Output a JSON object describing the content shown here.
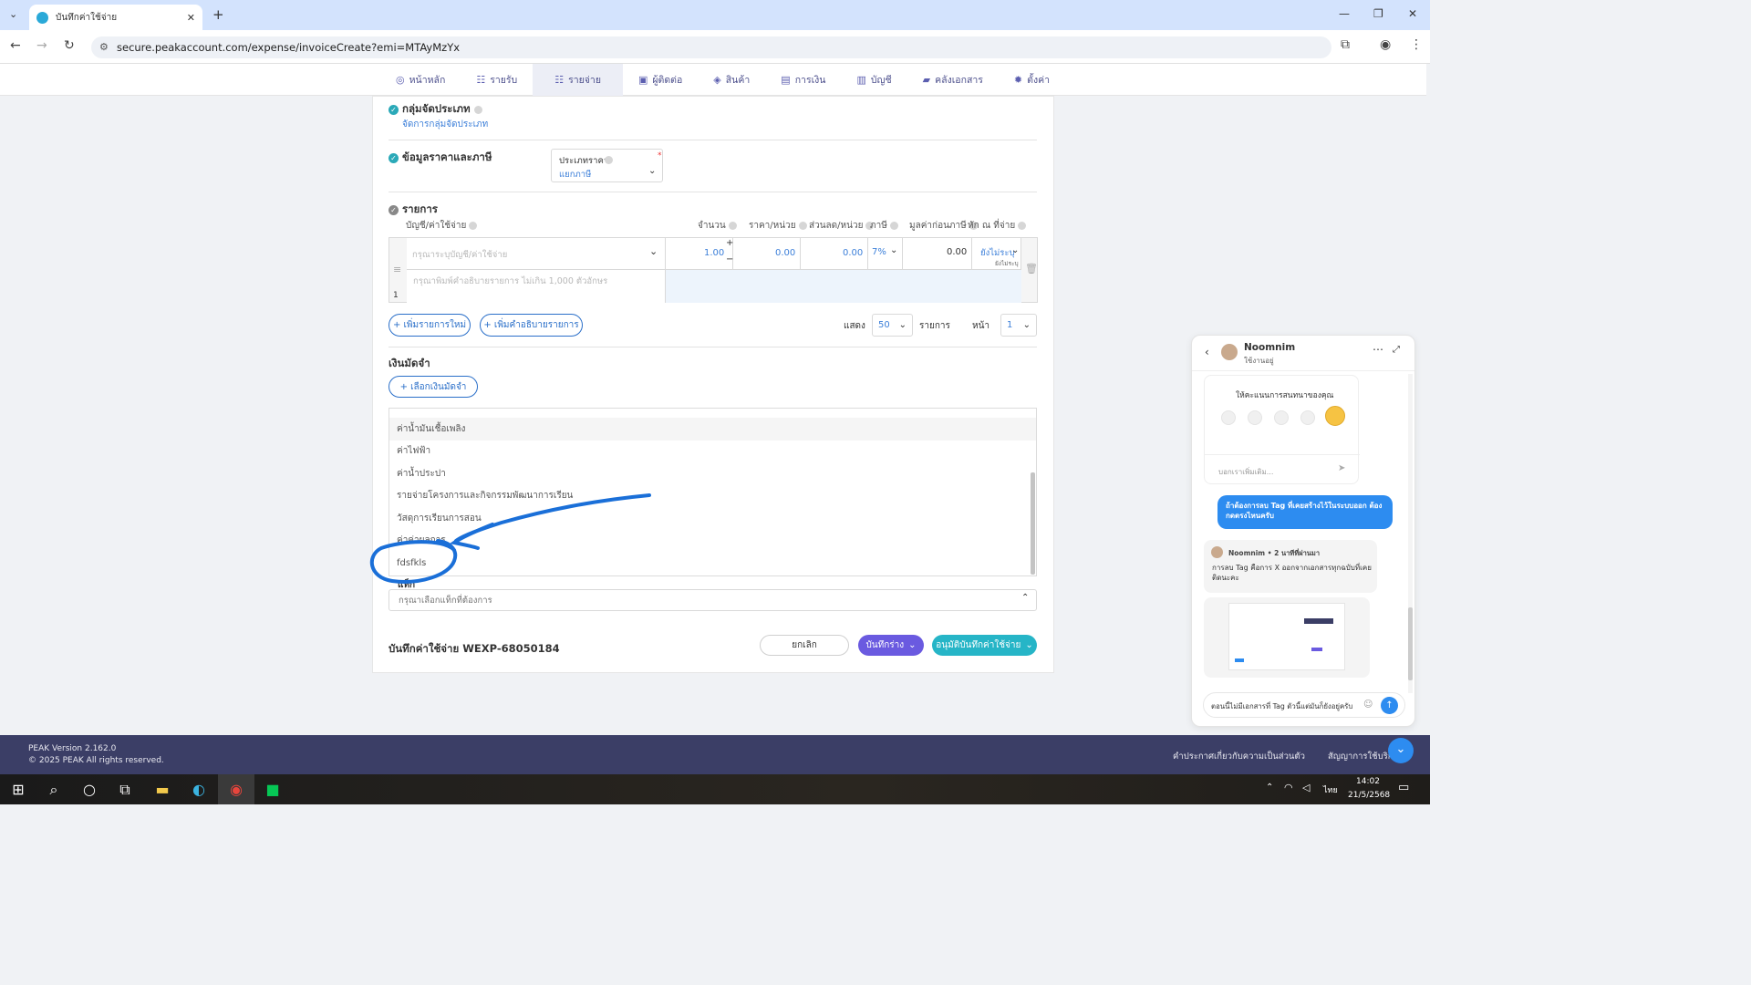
{
  "browser": {
    "tab_title": "บันทึกค่าใช้จ่าย",
    "url": "secure.peakaccount.com/expense/invoiceCreate?emi=MTAyMzYx"
  },
  "nav": {
    "items": [
      "หน้าหลัก",
      "รายรับ",
      "รายจ่าย",
      "ผู้ติดต่อ",
      "สินค้า",
      "การเงิน",
      "บัญชี",
      "คลังเอกสาร",
      "ตั้งค่า"
    ],
    "active": "รายจ่าย"
  },
  "form": {
    "group_section": "กลุ่มจัดประเภท",
    "group_link": "จัดการกลุ่มจัดประเภท",
    "price_section": "ข้อมูลราคาและภาษี",
    "price_type_label": "ประเภทราคา",
    "price_type_value": "แยกภาษี",
    "items_section": "รายการ",
    "columns": {
      "account": "บัญชี/ค่าใช้จ่าย",
      "qty": "จำนวน",
      "price": "ราคา/หน่วย",
      "discount": "ส่วนลด/หน่วย",
      "tax": "ภาษี",
      "pretax": "มูลค่าก่อนภาษี",
      "withholding": "หัก ณ ที่จ่าย"
    },
    "row": {
      "account_placeholder": "กรุณาระบุบัญชี/ค่าใช้จ่าย",
      "desc_placeholder": "กรุณาพิมพ์คำอธิบายรายการ ไม่เกิน 1,000 ตัวอักษร",
      "qty": "1.00",
      "price": "0.00",
      "discount": "0.00",
      "tax": "7%",
      "pretax": "0.00",
      "withholding": "ยังไม่ระบุ",
      "withholding_sub": "ยังไม่ระบุ",
      "index": "1"
    },
    "add_item": "+ เพิ่มรายการใหม่",
    "add_desc": "+ เพิ่มคำอธิบายรายการ",
    "show_label": "แสดง",
    "show_value": "50",
    "items_label": "รายการ",
    "page_label": "หน้า",
    "page_value": "1",
    "deposit_section": "เงินมัดจำ",
    "deposit_button": "+ เลือกเงินมัดจำ",
    "dropdown_items": [
      "ค่าน้ำมันเชื้อเพลิง",
      "ค่าไฟฟ้า",
      "ค่าน้ำประปา",
      "รายจ่ายโครงการและกิจกรรมพัฒนาการเรียน",
      "วัสดุการเรียนการสอน",
      "ค่าค่าผลการ",
      "fdsfkls"
    ],
    "tag_label": "แท็ก",
    "tag_placeholder": "กรุณาเลือกแท็กที่ต้องการ",
    "doc_title": "บันทึกค่าใช้จ่าย WEXP-68050184",
    "cancel": "ยกเลิก",
    "save_draft": "บันทึกร่าง",
    "approve": "อนุมัติบันทึกค่าใช้จ่าย"
  },
  "footer": {
    "version": "PEAK Version 2.162.0",
    "copyright": "© 2025 PEAK All rights reserved.",
    "privacy": "คำประกาศเกี่ยวกับความเป็นส่วนตัว",
    "terms": "สัญญาการใช้บริก"
  },
  "taskbar": {
    "time": "14:02",
    "date": "21/5/2568",
    "lang": "ไทย"
  },
  "chat": {
    "agent_name": "Noomnim",
    "agent_status": "ใช้งานอยู่",
    "rating_title": "ให้คะแนนการสนทนาของคุณ",
    "feedback_placeholder": "บอกเราเพิ่มเติม...",
    "user_message": "ถ้าต้องการลบ Tag ที่เคยสร้างไว้ในระบบออก ต้องกดตรงไหนครับ",
    "agent_meta": "Noomnim • 2 นาทีที่ผ่านมา",
    "agent_message": "การลบ Tag คือการ X ออกจากเอกสารทุกฉบับที่เคยติดนะคะ",
    "input_value": "ตอนนี้ไม่มีเอกสารที่ Tag ตัวนี้แต่มันก็ยังอยู่ครับ"
  },
  "colors": {
    "accent": "#3c7fd9",
    "draft": "#6a5ae0",
    "approve": "#26b5c7",
    "annotation": "#1a6fd8"
  }
}
